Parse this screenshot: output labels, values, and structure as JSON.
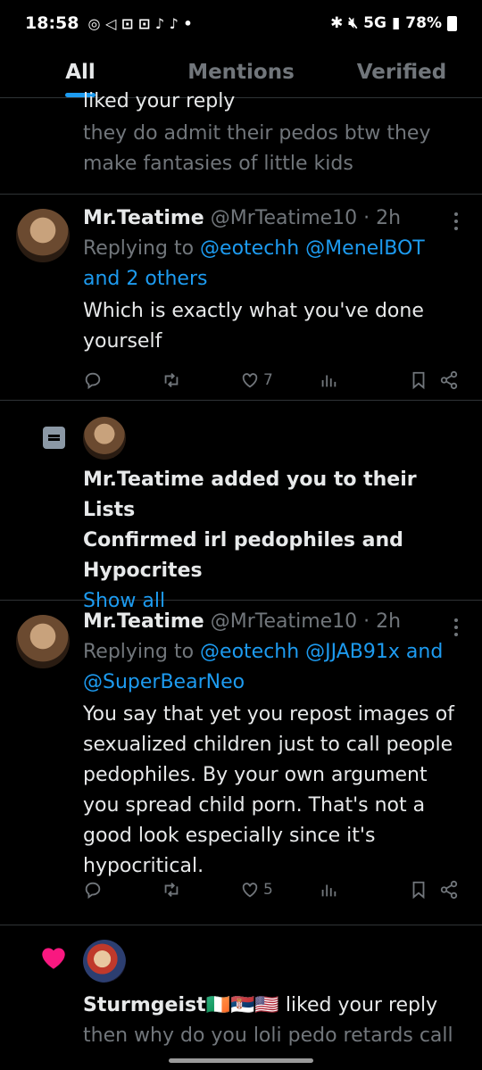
{
  "status_bar": {
    "time": "18:58",
    "network": "5G",
    "battery": "78%"
  },
  "tabs": [
    {
      "label": "All",
      "active": true
    },
    {
      "label": "Mentions",
      "active": false
    },
    {
      "label": "Verified",
      "active": false
    }
  ],
  "items": [
    {
      "type": "like-partial",
      "action_text": "liked your reply",
      "preview_line1": "they do admit their pedos btw they",
      "preview_line2": "make fantasies of little kids"
    },
    {
      "type": "reply",
      "name": "Mr.Teatime",
      "handle": "@MrTeatime10",
      "time": "· 2h",
      "replying_prefix": "Replying to",
      "replying_to_1": "@eotechh",
      "replying_to_2": "@MenelBOT",
      "replying_to_3": "and 2 others",
      "body_line1": "Which is exactly what you've done",
      "body_line2": "yourself",
      "likes": "7"
    },
    {
      "type": "list",
      "line1": "Mr.Teatime added you to their Lists",
      "line2": "Confirmed irl pedophiles and",
      "line3": "Hypocrites",
      "link": "Show all"
    },
    {
      "type": "reply",
      "name": "Mr.Teatime",
      "handle": "@MrTeatime10",
      "time": "· 2h",
      "replying_prefix": "Replying to",
      "replying_to_1": "@eotechh",
      "replying_to_2": "@JJAB91x",
      "replying_to_3": "and",
      "replying_to_4": "@SuperBearNeo",
      "body_lines": [
        "You say that yet you repost images of",
        "sexualized children just to call people",
        "pedophiles. By your own argument",
        "you spread child porn. That's not a",
        "good look especially since it's",
        "hypocritical."
      ],
      "likes": "5"
    },
    {
      "type": "like",
      "name": "Sturmgeist",
      "flags": "🇮🇪🇷🇸🇺🇸",
      "action_text": "liked your reply",
      "preview_line1": "then why do you loli pedo retards call"
    }
  ],
  "icons": {
    "reply": "reply-icon",
    "retweet": "retweet-icon",
    "like": "heart-icon",
    "views": "views-icon",
    "bookmark": "bookmark-icon",
    "share": "share-icon",
    "list": "list-icon",
    "liked": "liked-heart-icon"
  },
  "colors": {
    "accent": "#1d9bf0",
    "like_pink": "#f91880",
    "muted": "#71767b"
  }
}
